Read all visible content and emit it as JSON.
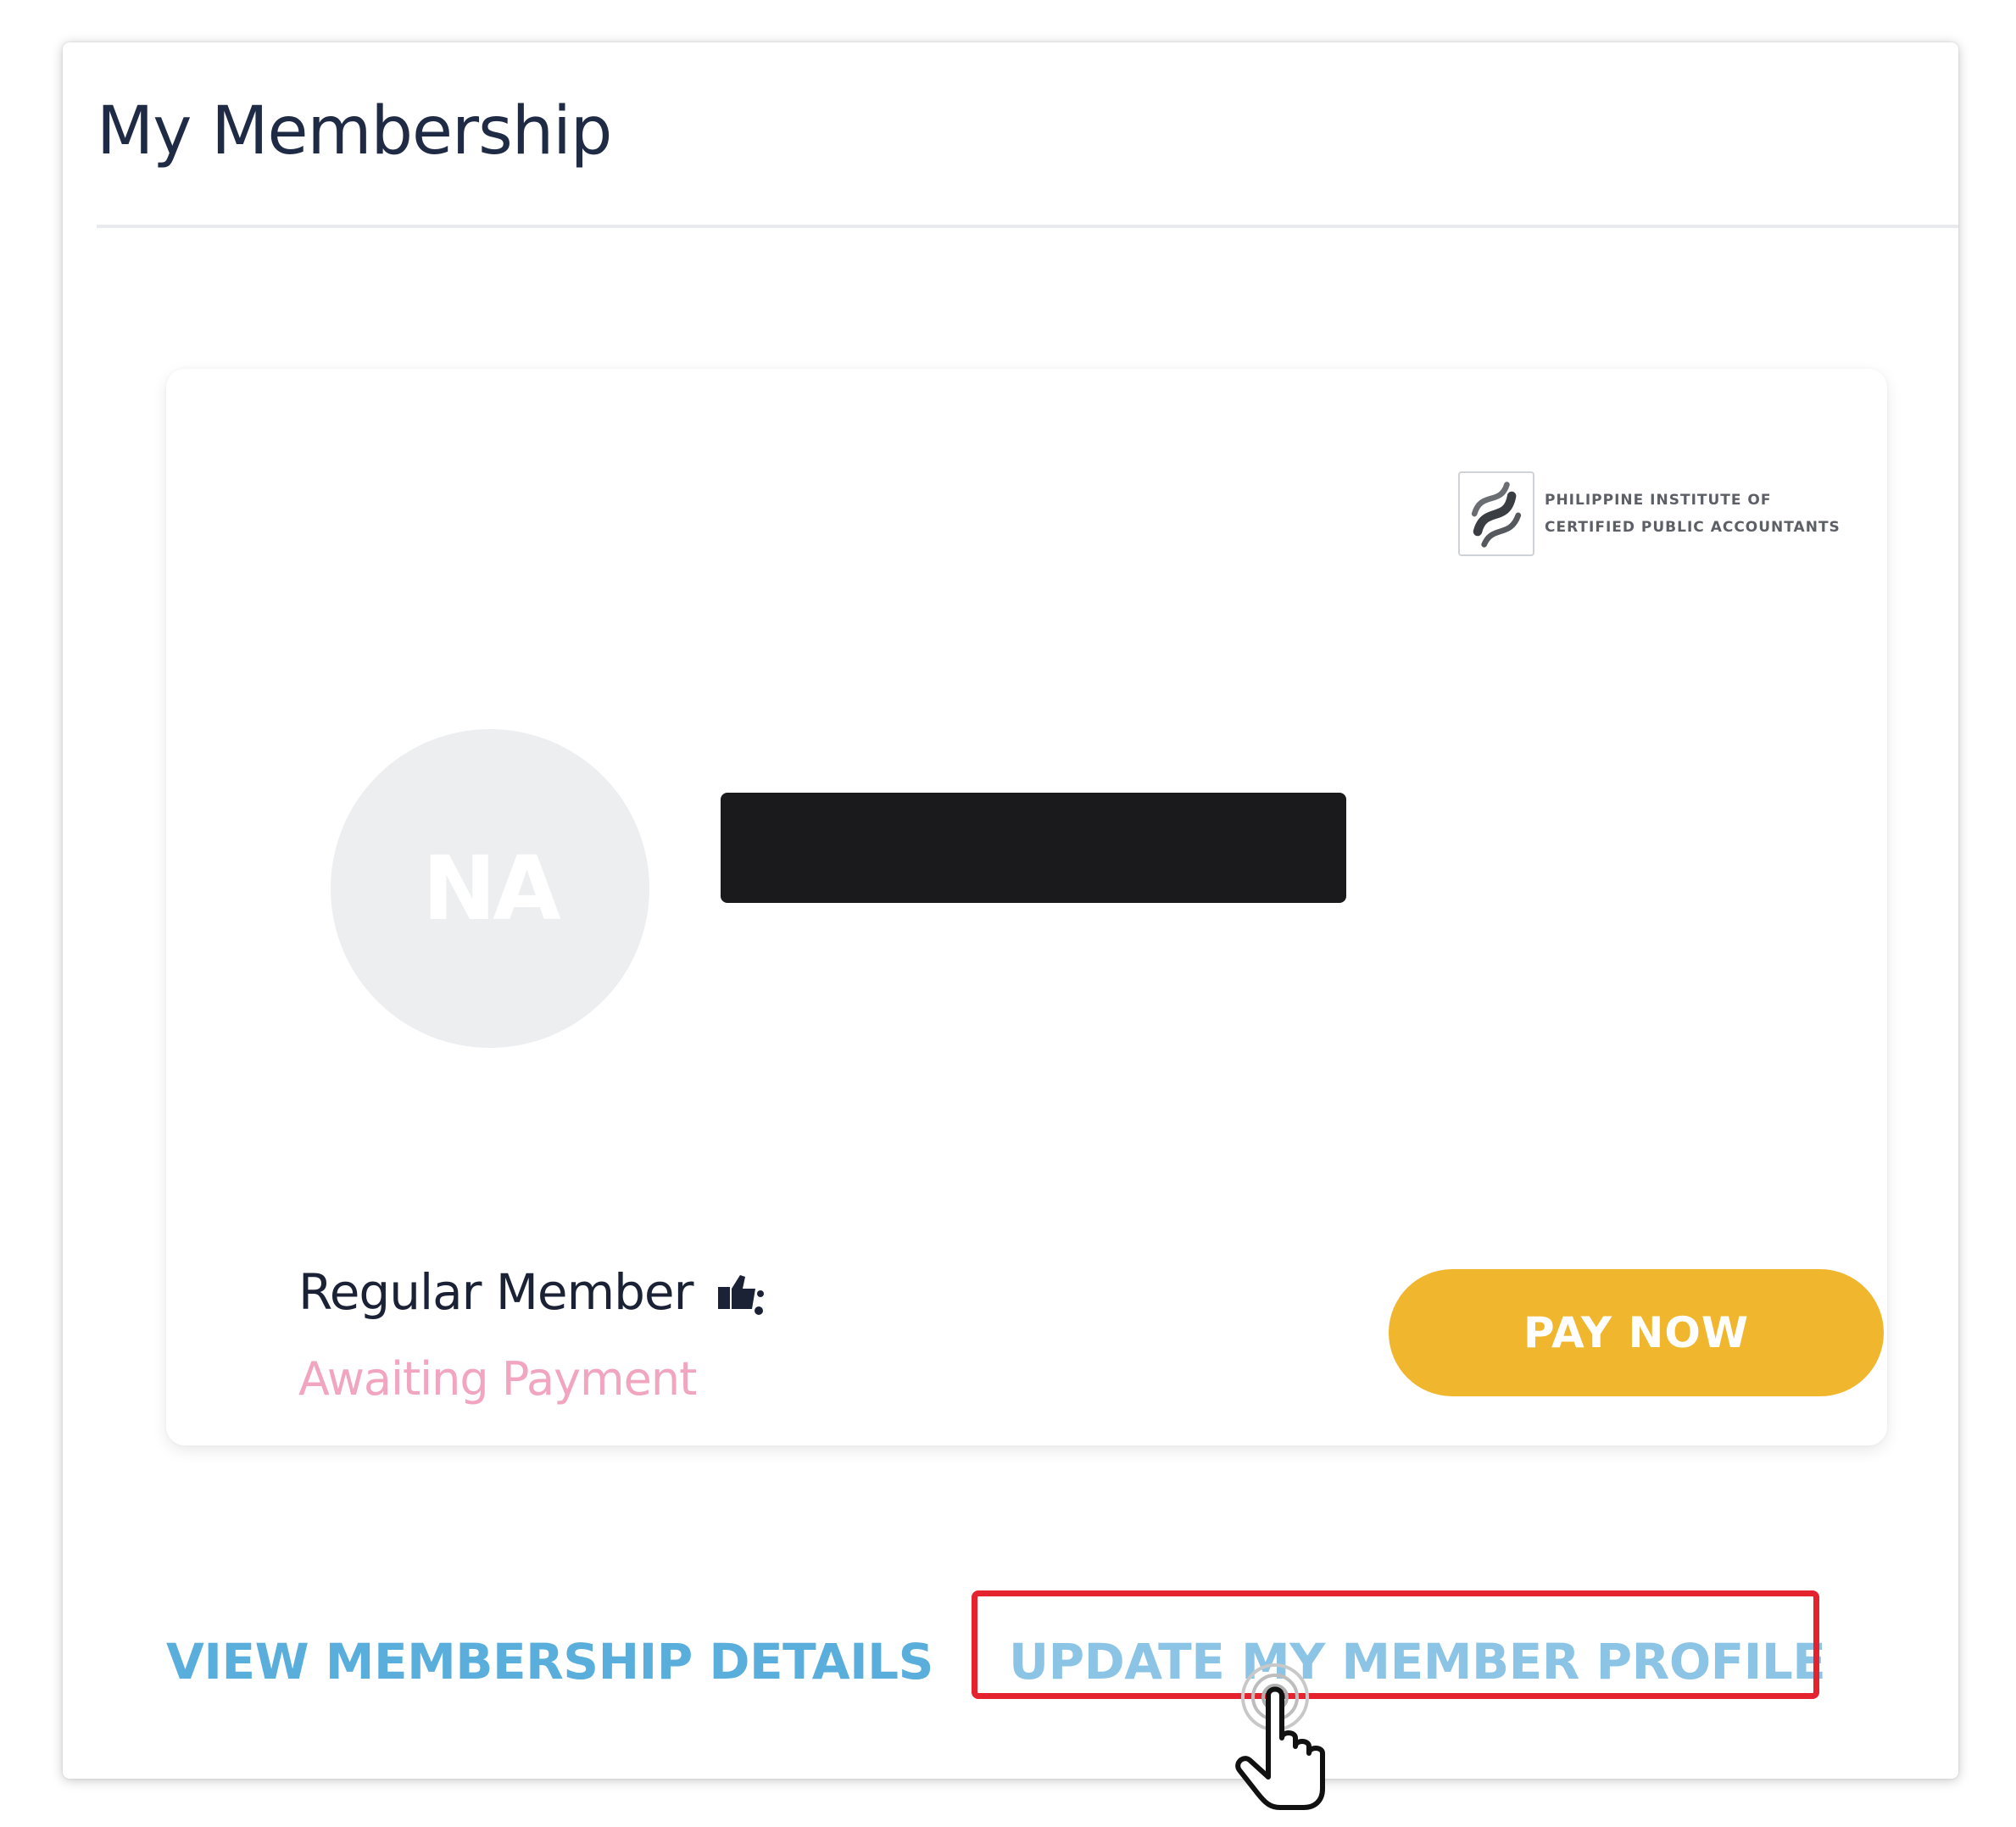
{
  "panel": {
    "title": "My Membership"
  },
  "card": {
    "org_logo_line1": "Philippine Institute of",
    "org_logo_line2": "Certified Public Accountants",
    "avatar_initials": "NA",
    "member_type": "Regular Member",
    "member_status": "Awaiting Payment",
    "pay_button_label": "PAY NOW"
  },
  "links": {
    "view_details": "VIEW MEMBERSHIP DETAILS",
    "update_profile": "UPDATE MY MEMBER PROFILE"
  },
  "icons": {
    "verified": "verified-badge-icon",
    "logo": "organization-logo-icon",
    "cursor": "hand-pointer-cursor-icon"
  },
  "colors": {
    "title": "#1f2a44",
    "status_awaiting": "#f2a5bf",
    "pay_button": "#f0b72e",
    "link": "#5aaedc",
    "highlight": "#e4232f"
  }
}
